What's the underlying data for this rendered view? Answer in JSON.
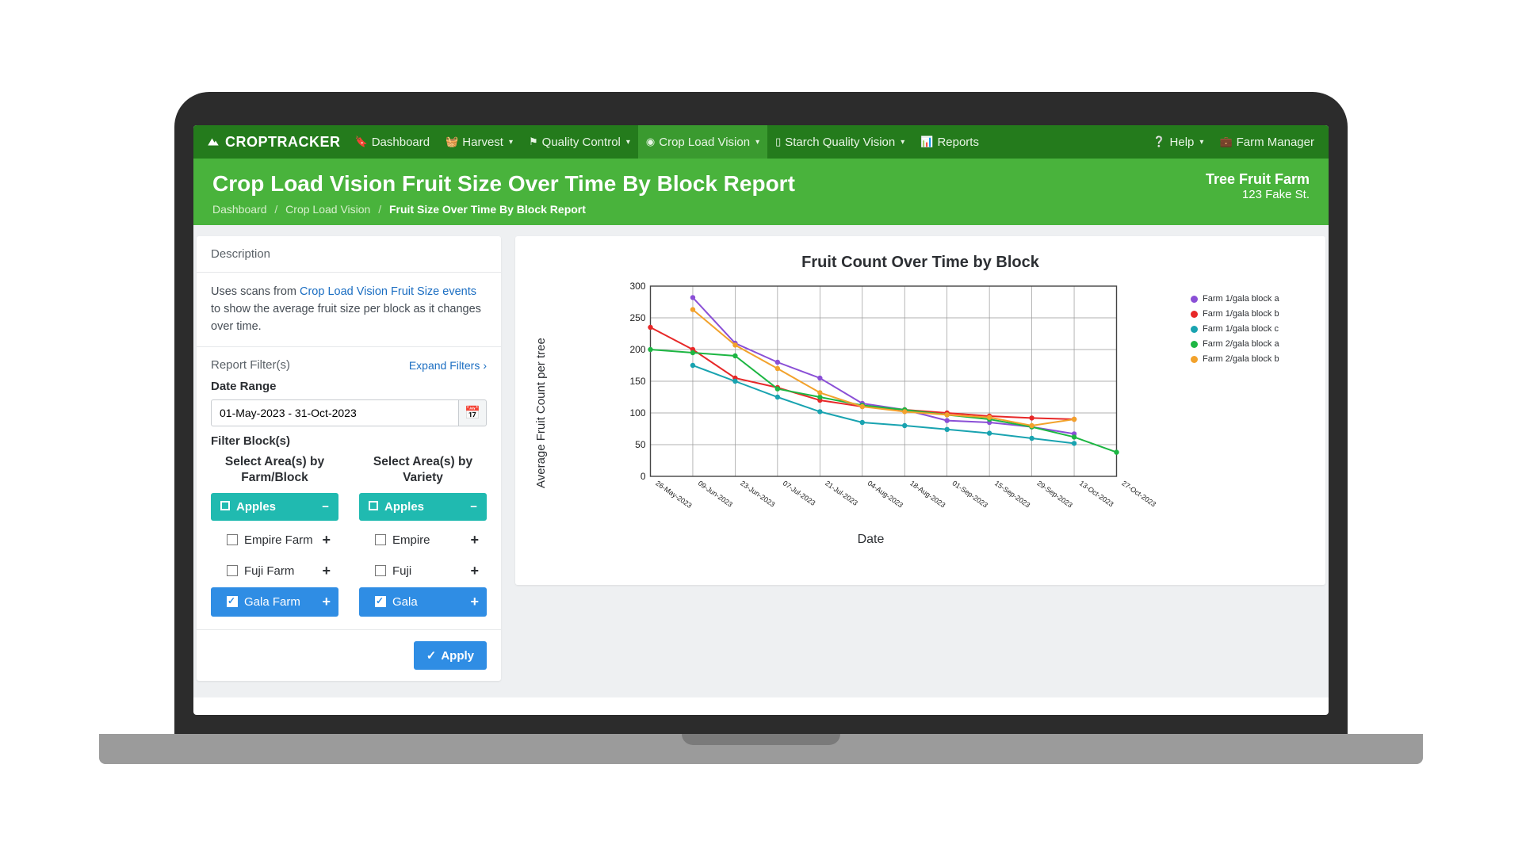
{
  "brand": "CROPTRACKER",
  "nav": {
    "dashboard": "Dashboard",
    "harvest": "Harvest",
    "quality": "Quality Control",
    "cropload": "Crop Load Vision",
    "starch": "Starch Quality Vision",
    "reports": "Reports",
    "help": "Help",
    "user": "Farm Manager"
  },
  "header": {
    "title": "Crop Load Vision Fruit Size Over Time By Block Report",
    "breadcrumb": {
      "a": "Dashboard",
      "b": "Crop Load Vision",
      "c": "Fruit Size Over Time By Block Report"
    },
    "farm_name": "Tree Fruit Farm",
    "farm_addr": "123 Fake St."
  },
  "sidebar": {
    "desc_title": "Description",
    "desc_before": "Uses scans from ",
    "desc_link": "Crop Load Vision Fruit Size events",
    "desc_after": " to show the average fruit size per block as it changes over time.",
    "filters_title": "Report Filter(s)",
    "expand": "Expand Filters",
    "date_label": "Date Range",
    "date_value": "01-May-2023 - 31-Oct-2023",
    "blocks_label": "Filter Block(s)",
    "col1_title": "Select Area(s) by Farm/Block",
    "col2_title": "Select Area(s) by Variety",
    "root": "Apples",
    "farm_items": [
      "Empire Farm",
      "Fuji Farm",
      "Gala Farm"
    ],
    "variety_items": [
      "Empire",
      "Fuji",
      "Gala"
    ],
    "apply": "Apply"
  },
  "chart_data": {
    "type": "line",
    "title": "Fruit Count Over Time by Block",
    "xlabel": "Date",
    "ylabel": "Average Fruit Count per tree",
    "ylim": [
      0,
      300
    ],
    "categories": [
      "26-May-2023",
      "09-Jun-2023",
      "23-Jun-2023",
      "07-Jul-2023",
      "21-Jul-2023",
      "04-Aug-2023",
      "18-Aug-2023",
      "01-Sep-2023",
      "15-Sep-2023",
      "29-Sep-2023",
      "13-Oct-2023",
      "27-Oct-2023"
    ],
    "series": [
      {
        "name": "Farm 1/gala block a",
        "color": "#8a4fd6",
        "values": [
          null,
          282,
          210,
          180,
          155,
          115,
          105,
          88,
          85,
          78,
          67,
          null
        ]
      },
      {
        "name": "Farm 1/gala block b",
        "color": "#e72828",
        "values": [
          235,
          200,
          155,
          140,
          120,
          110,
          105,
          100,
          95,
          92,
          90,
          null
        ]
      },
      {
        "name": "Farm 1/gala block c",
        "color": "#19a3b0",
        "values": [
          null,
          175,
          150,
          125,
          102,
          85,
          80,
          74,
          68,
          60,
          52,
          null
        ]
      },
      {
        "name": "Farm 2/gala block a",
        "color": "#1db643",
        "values": [
          200,
          195,
          190,
          138,
          125,
          112,
          105,
          97,
          90,
          78,
          62,
          38
        ]
      },
      {
        "name": "Farm 2/gala block b",
        "color": "#f2a22c",
        "values": [
          null,
          263,
          207,
          170,
          132,
          110,
          102,
          97,
          93,
          80,
          90,
          null
        ]
      }
    ]
  }
}
